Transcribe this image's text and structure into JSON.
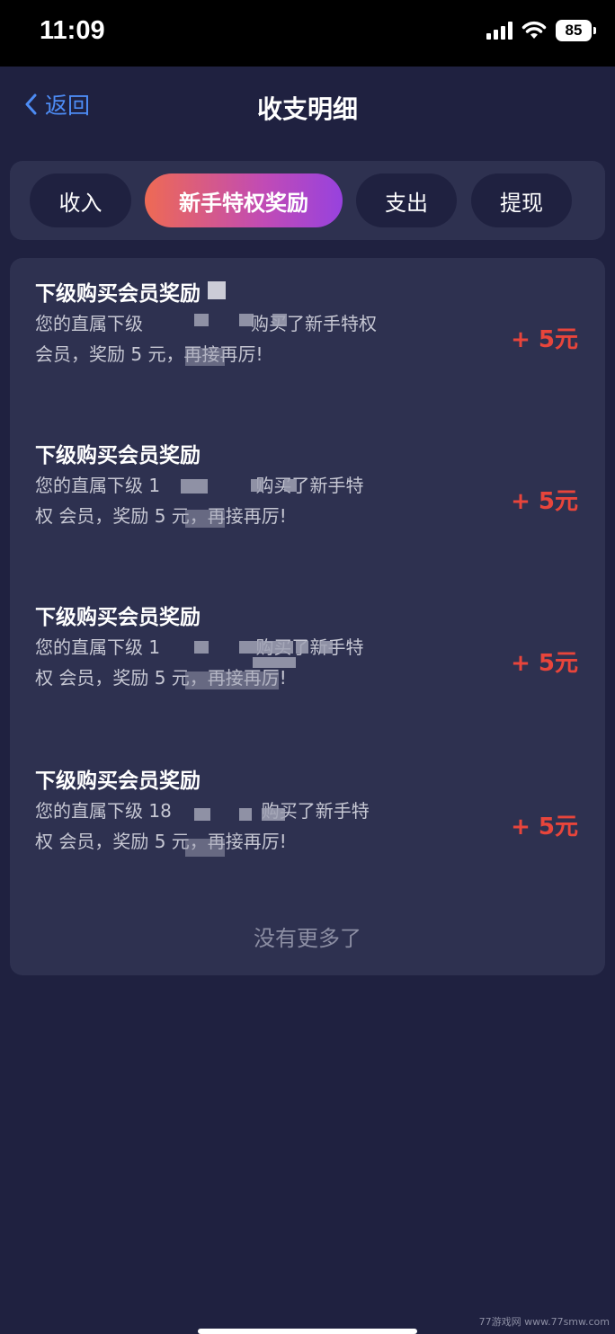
{
  "status_bar": {
    "time": "11:09",
    "battery": "85"
  },
  "nav": {
    "back_label": "返回",
    "title": "收支明细"
  },
  "tabs": [
    {
      "label": "收入",
      "active": false
    },
    {
      "label": "新手特权奖励",
      "active": true
    },
    {
      "label": "支出",
      "active": false
    },
    {
      "label": "提现",
      "active": false
    }
  ],
  "records": [
    {
      "title": "下级购买会员奖励",
      "desc": "您的直属下级　　　　　　购买了新手特权 会员，奖励 5 元，再接再厉!",
      "amount": "+ 5元"
    },
    {
      "title": "下级购买会员奖励",
      "desc": "您的直属下级 1　　　　　 购买了新手特权 会员，奖励 5 元，再接再厉!",
      "amount": "+ 5元"
    },
    {
      "title": "下级购买会员奖励",
      "desc": "您的直属下级 1　　　　　 购买了新手特权 会员，奖励 5 元，再接再厉!",
      "amount": "+ 5元"
    },
    {
      "title": "下级购买会员奖励",
      "desc": "您的直属下级 18　　　　　购买了新手特权 会员，奖励 5 元，再接再厉!",
      "amount": "+ 5元"
    }
  ],
  "footer": {
    "text": "没有更多了"
  },
  "watermark": "77游戏网 www.77smw.com",
  "colors": {
    "background": "#1f2140",
    "panel": "#2e3150",
    "amount": "#e8453b",
    "accent": "#4d8cf5"
  }
}
